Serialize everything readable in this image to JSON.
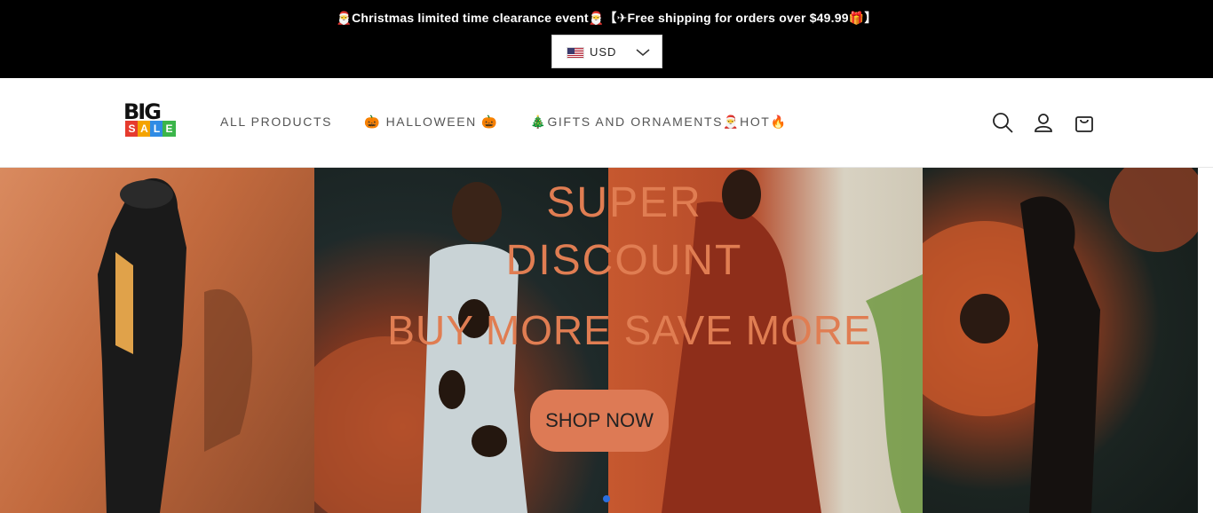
{
  "announcement": {
    "text": "🎅Christmas limited time clearance event🎅【✈Free shipping for orders over $49.99🎁】"
  },
  "currency": {
    "label": "USD",
    "flag_icon": "us-flag-icon"
  },
  "header": {
    "logo": {
      "top": "BIG",
      "letters": [
        "S",
        "A",
        "L",
        "E"
      ],
      "letter_colors": [
        "#e63b2e",
        "#f4a300",
        "#2f8be5",
        "#3bb54a"
      ]
    },
    "nav": [
      "ALL PRODUCTS",
      "🎃 HALLOWEEN 🎃",
      "🎄GIFTS AND ORNAMENTS🎅HOT🔥"
    ],
    "icons": [
      "search-icon",
      "account-icon",
      "cart-icon"
    ]
  },
  "hero": {
    "title_line1": "SUPER",
    "title_line2": "DISCOUNT",
    "subtitle": "BUY MORE SAVE MORE",
    "button_label": "SHOP NOW",
    "accent_color": "#e07d52",
    "slide_indicator_color": "#2b6fe0"
  }
}
